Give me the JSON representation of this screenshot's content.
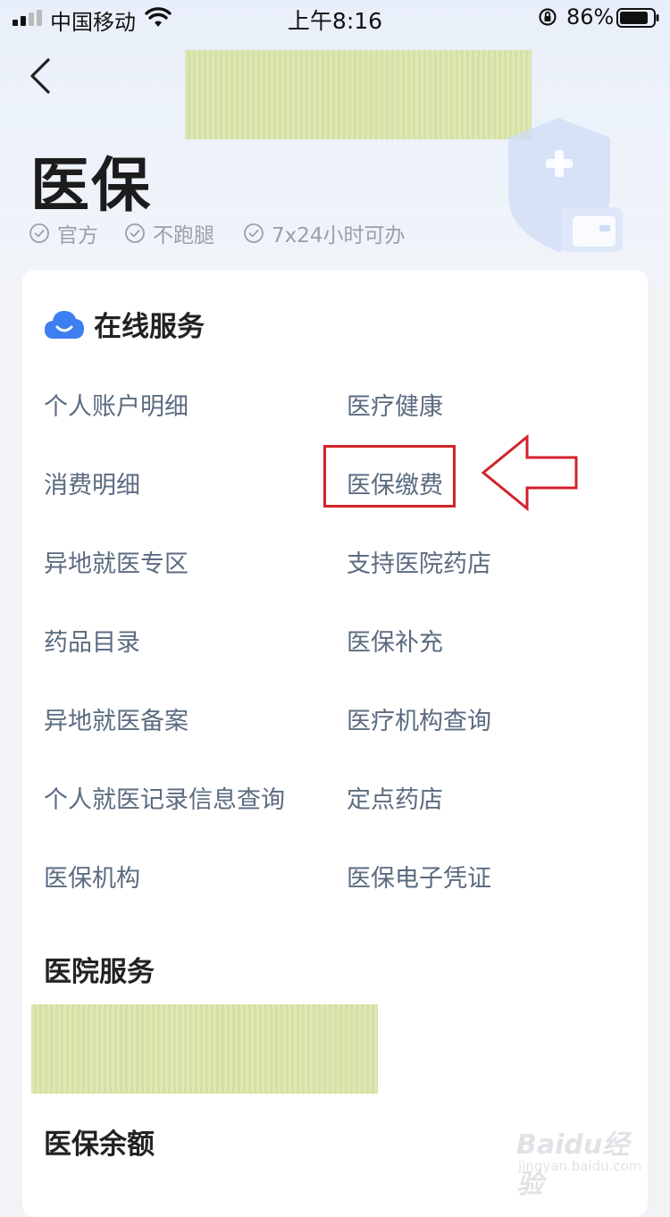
{
  "status_bar": {
    "carrier": "中国移动",
    "time": "上午8:16",
    "battery_percent": "86%",
    "battery_level": 0.86
  },
  "header": {
    "title": "医保",
    "badges": [
      "官方",
      "不跑腿",
      "7x24小时可办"
    ]
  },
  "online_services": {
    "title": "在线服务",
    "left_column": [
      "个人账户明细",
      "消费明细",
      "异地就医专区",
      "药品目录",
      "异地就医备案",
      "个人就医记录信息查询",
      "医保机构"
    ],
    "right_column": [
      "医疗健康",
      "医保缴费",
      "支持医院药店",
      "医保补充",
      "医疗机构查询",
      "定点药店",
      "医保电子凭证"
    ],
    "highlighted_item": "医保缴费"
  },
  "hospital_services": {
    "title": "医院服务"
  },
  "insurance_balance": {
    "title": "医保余额"
  },
  "watermark": {
    "logo": "Baidu经验",
    "url": "jingyan.baidu.com"
  },
  "colors": {
    "accent_blue": "#3d7ef0",
    "highlight_red": "#d3222a",
    "service_text": "#5b6b80",
    "badge_text": "#9aa0a8",
    "redaction": "#d9e5a9"
  },
  "icons": {
    "back": "chevron-left-icon",
    "cloud": "cloud-smile-icon",
    "badge_check": "check-circle-icon",
    "annotation": "left-arrow-icon"
  }
}
